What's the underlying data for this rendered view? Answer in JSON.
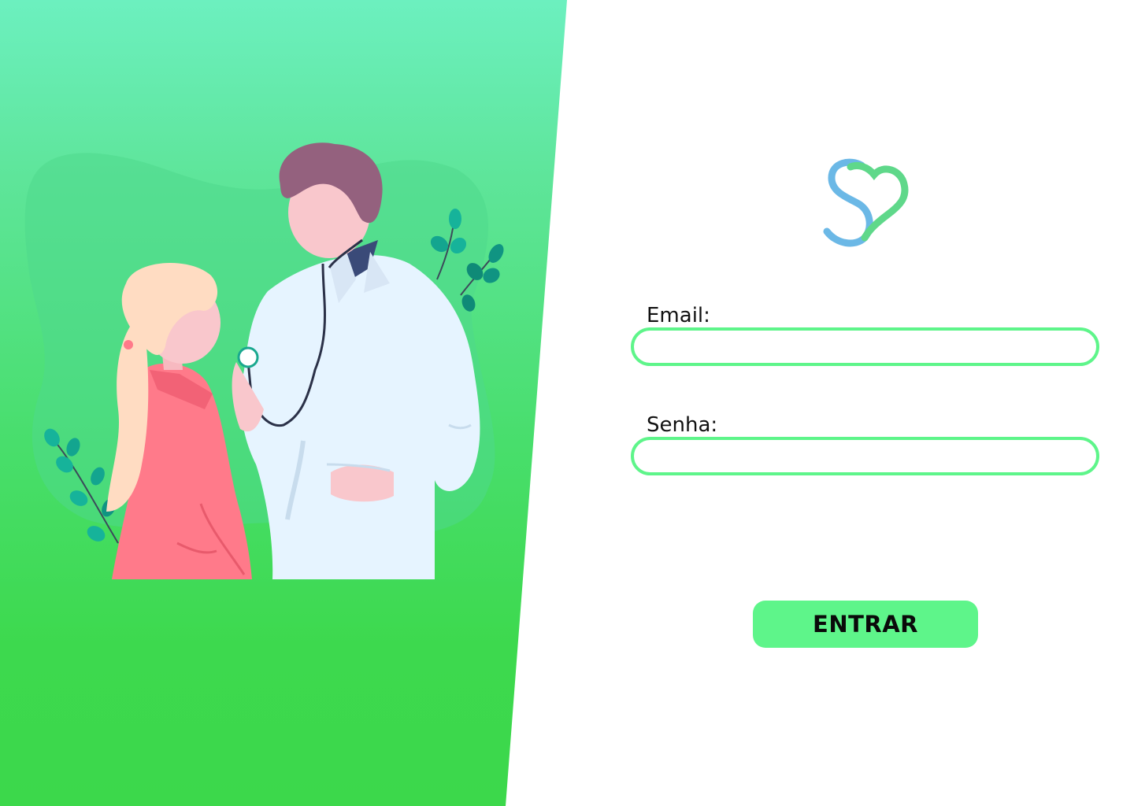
{
  "login": {
    "email_label": "Email:",
    "password_label": "Senha:",
    "email_value": "",
    "password_value": "",
    "submit_label": "ENTRAR"
  },
  "icons": {
    "logo": "s-heart-logo-icon",
    "illustration": "doctor-patient-illustration"
  },
  "colors": {
    "accent": "#5ef58a",
    "panel_top": "#6cf0bf",
    "panel_bottom": "#3cd84b",
    "logo_blue": "#6bb8e6",
    "logo_green": "#5fd88a"
  }
}
